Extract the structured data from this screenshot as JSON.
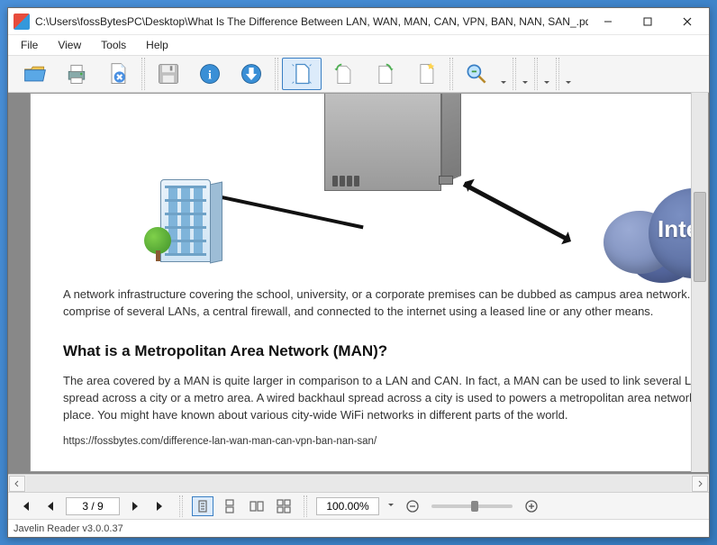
{
  "window": {
    "title": "C:\\Users\\fossBytesPC\\Desktop\\What Is The Difference Between LAN, WAN, MAN, CAN, VPN, BAN, NAN, SAN_.pdf"
  },
  "menu": {
    "file": "File",
    "view": "View",
    "tools": "Tools",
    "help": "Help"
  },
  "cloud_label": "Internet",
  "document": {
    "para1": "A network infrastructure covering the school, university, or a corporate premises can be dubbed as campus area network. It can comprise of several LANs, a central firewall, and connected to the internet using a leased line or any other means.",
    "heading": "What is a Metropolitan Area Network (MAN)?",
    "para2": "The area covered by a MAN is quite larger in comparison to a LAN and CAN. In fact, a MAN can be used to link several LANs spread across a city or a metro area. A wired backhaul spread across a city is used to powers a metropolitan area network in that place. You might have known about various city-wide WiFi networks in different parts of the world.",
    "url": "https://fossbytes.com/difference-lan-wan-man-can-vpn-ban-nan-san/"
  },
  "nav": {
    "page_display": "3 / 9"
  },
  "zoom": {
    "value": "100.00%"
  },
  "status": {
    "text": "Javelin Reader v3.0.0.37"
  }
}
